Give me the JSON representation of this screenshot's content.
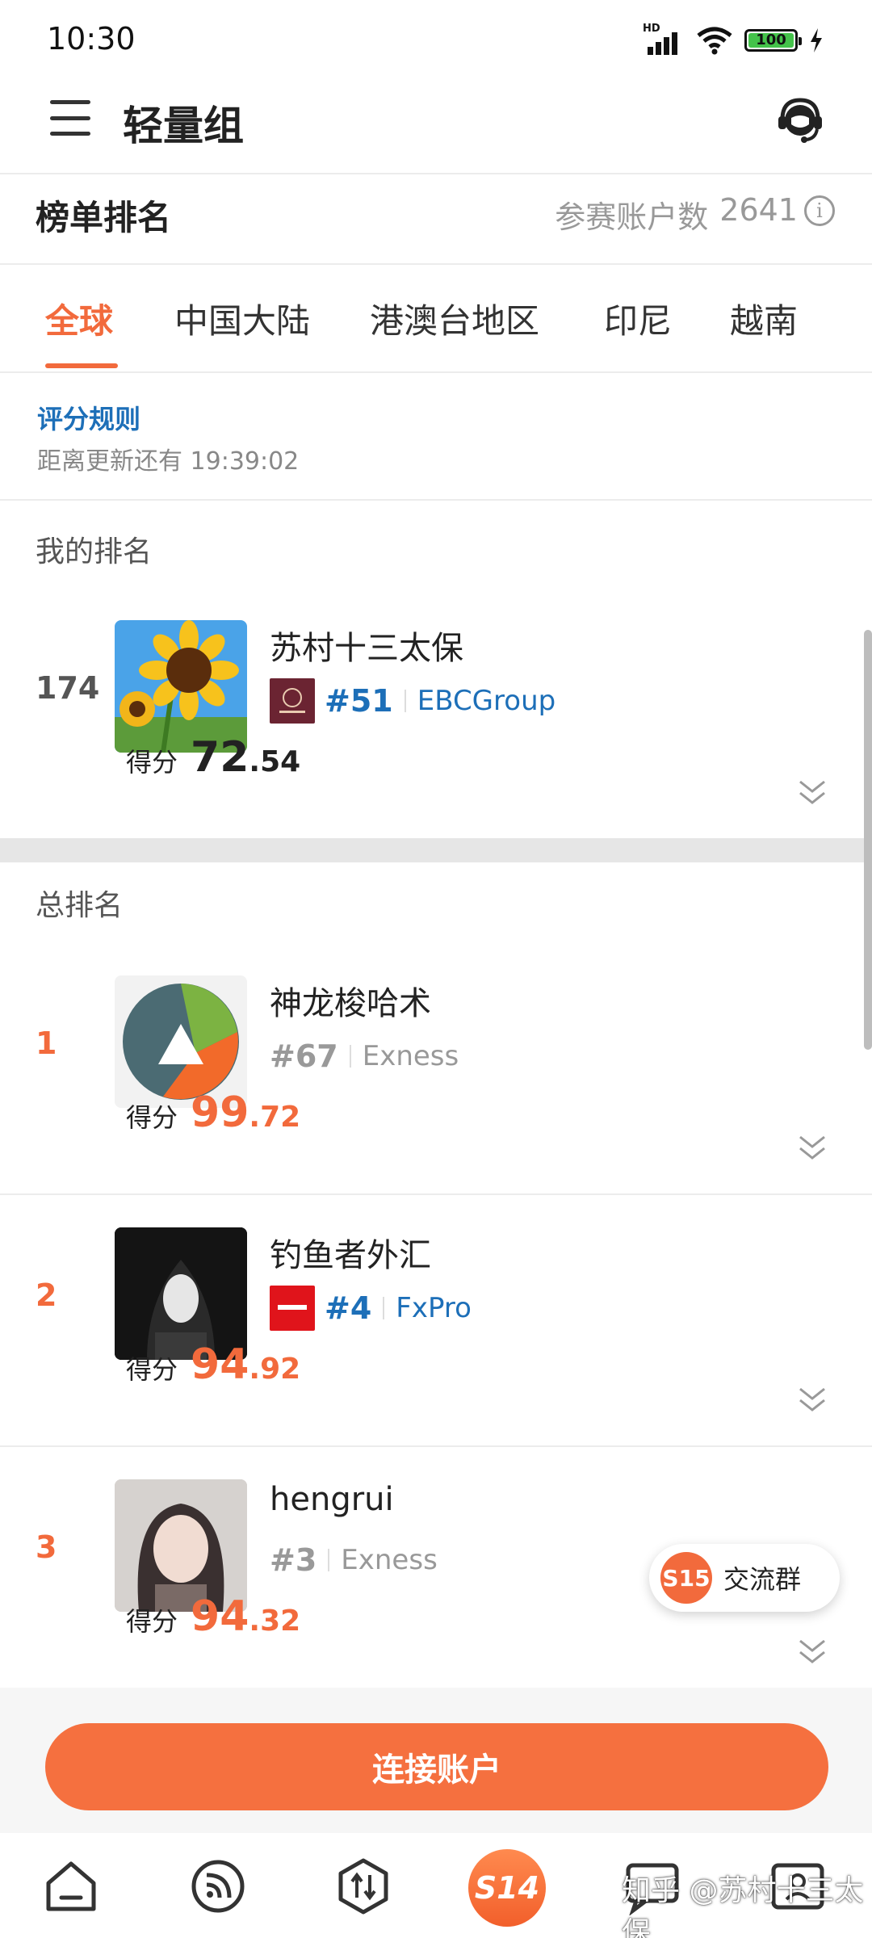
{
  "status_bar": {
    "time": "10:30",
    "battery": "100"
  },
  "header": {
    "title": "轻量组"
  },
  "leaderboard": {
    "title": "榜单排名",
    "participants_label": "参赛账户数",
    "participants_count": "2641"
  },
  "region_tabs": [
    {
      "label": "全球",
      "active": true
    },
    {
      "label": "中国大陆",
      "active": false
    },
    {
      "label": "港澳台地区",
      "active": false
    },
    {
      "label": "印尼",
      "active": false
    },
    {
      "label": "越南",
      "active": false
    }
  ],
  "rules": {
    "link": "评分规则",
    "countdown": "距离更新还有 19:39:02"
  },
  "my_rank": {
    "section_label": "我的排名",
    "rank": "174",
    "nickname": "苏村十三太保",
    "broker_rank": "#51",
    "broker": "EBCGroup",
    "score_label": "得分",
    "score_int": "72",
    "score_dec": ".54"
  },
  "overall": {
    "section_label": "总排名",
    "entries": [
      {
        "rank": "1",
        "nickname": "神龙梭哈术",
        "broker_rank": "#67",
        "broker": "Exness",
        "score_label": "得分",
        "score_int": "99",
        "score_dec": ".72"
      },
      {
        "rank": "2",
        "nickname": "钓鱼者外汇",
        "broker_rank": "#4",
        "broker": "FxPro",
        "score_label": "得分",
        "score_int": "94",
        "score_dec": ".92"
      },
      {
        "rank": "3",
        "nickname": "hengrui",
        "broker_rank": "#3",
        "broker": "Exness",
        "score_label": "得分",
        "score_int": "94",
        "score_dec": ".32"
      }
    ]
  },
  "community_fab": {
    "badge": "S15",
    "label": "交流群"
  },
  "connect_button": {
    "label": "连接账户"
  },
  "bottom_nav": {
    "items": [
      "home-icon",
      "feed-icon",
      "trade-icon",
      "season-icon",
      "chat-icon",
      "profile-icon"
    ],
    "season_badge": "S14"
  },
  "watermark": "知乎 @苏村十三太保",
  "colors": {
    "accent": "#f26a3c",
    "link": "#1d6fb8",
    "button": "#f5703f"
  }
}
